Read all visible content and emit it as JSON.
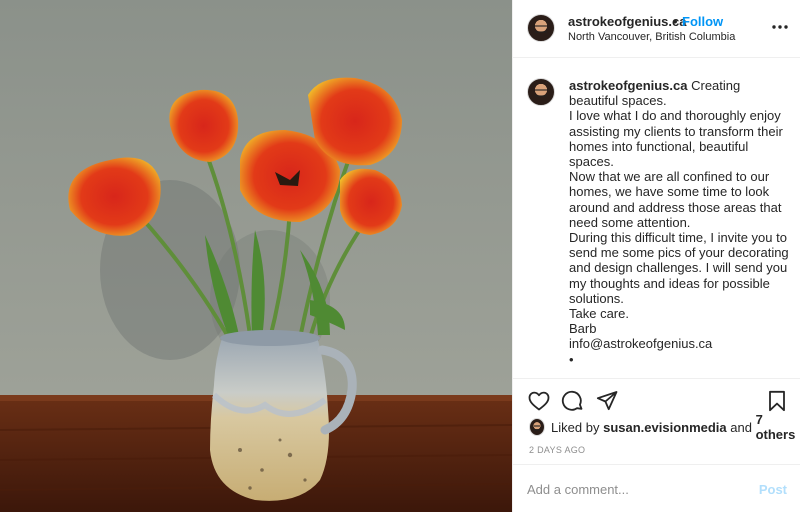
{
  "post": {
    "image_alt": "",
    "header": {
      "username": "astrokeofgenius.ca",
      "separator": "•",
      "follow_label": "Follow",
      "location": "North Vancouver, British Columbia",
      "more_icon": "more-horizontal-icon"
    },
    "caption": {
      "username": "astrokeofgenius.ca",
      "lines": [
        " Creating beautiful spaces.",
        "I love what I do and thoroughly enjoy assisting my clients to transform their homes into functional, beautiful spaces.",
        "Now that we are all confined to our homes, we have some time to look around and address those areas that need some attention.",
        "During this difficult time, I invite you to send me some pics of your decorating and design challenges. I will send you my thoughts and ideas for possible solutions.",
        "Take care.",
        "Barb",
        "info@astrokeofgenius.ca",
        "•"
      ]
    },
    "actions": {
      "like_icon": "heart-icon",
      "comment_icon": "comment-icon",
      "share_icon": "paper-plane-icon",
      "save_icon": "bookmark-icon"
    },
    "likes": {
      "prefix": "Liked by ",
      "user": "susan.evisionmedia",
      "middle": " and ",
      "others": "7 others"
    },
    "timestamp": "2 DAYS AGO",
    "comment": {
      "placeholder": "Add a comment...",
      "post_label": "Post"
    },
    "colors": {
      "follow_blue": "#0095f6",
      "post_disabled": "#b2dffc",
      "muted": "#8e8e8e"
    }
  }
}
